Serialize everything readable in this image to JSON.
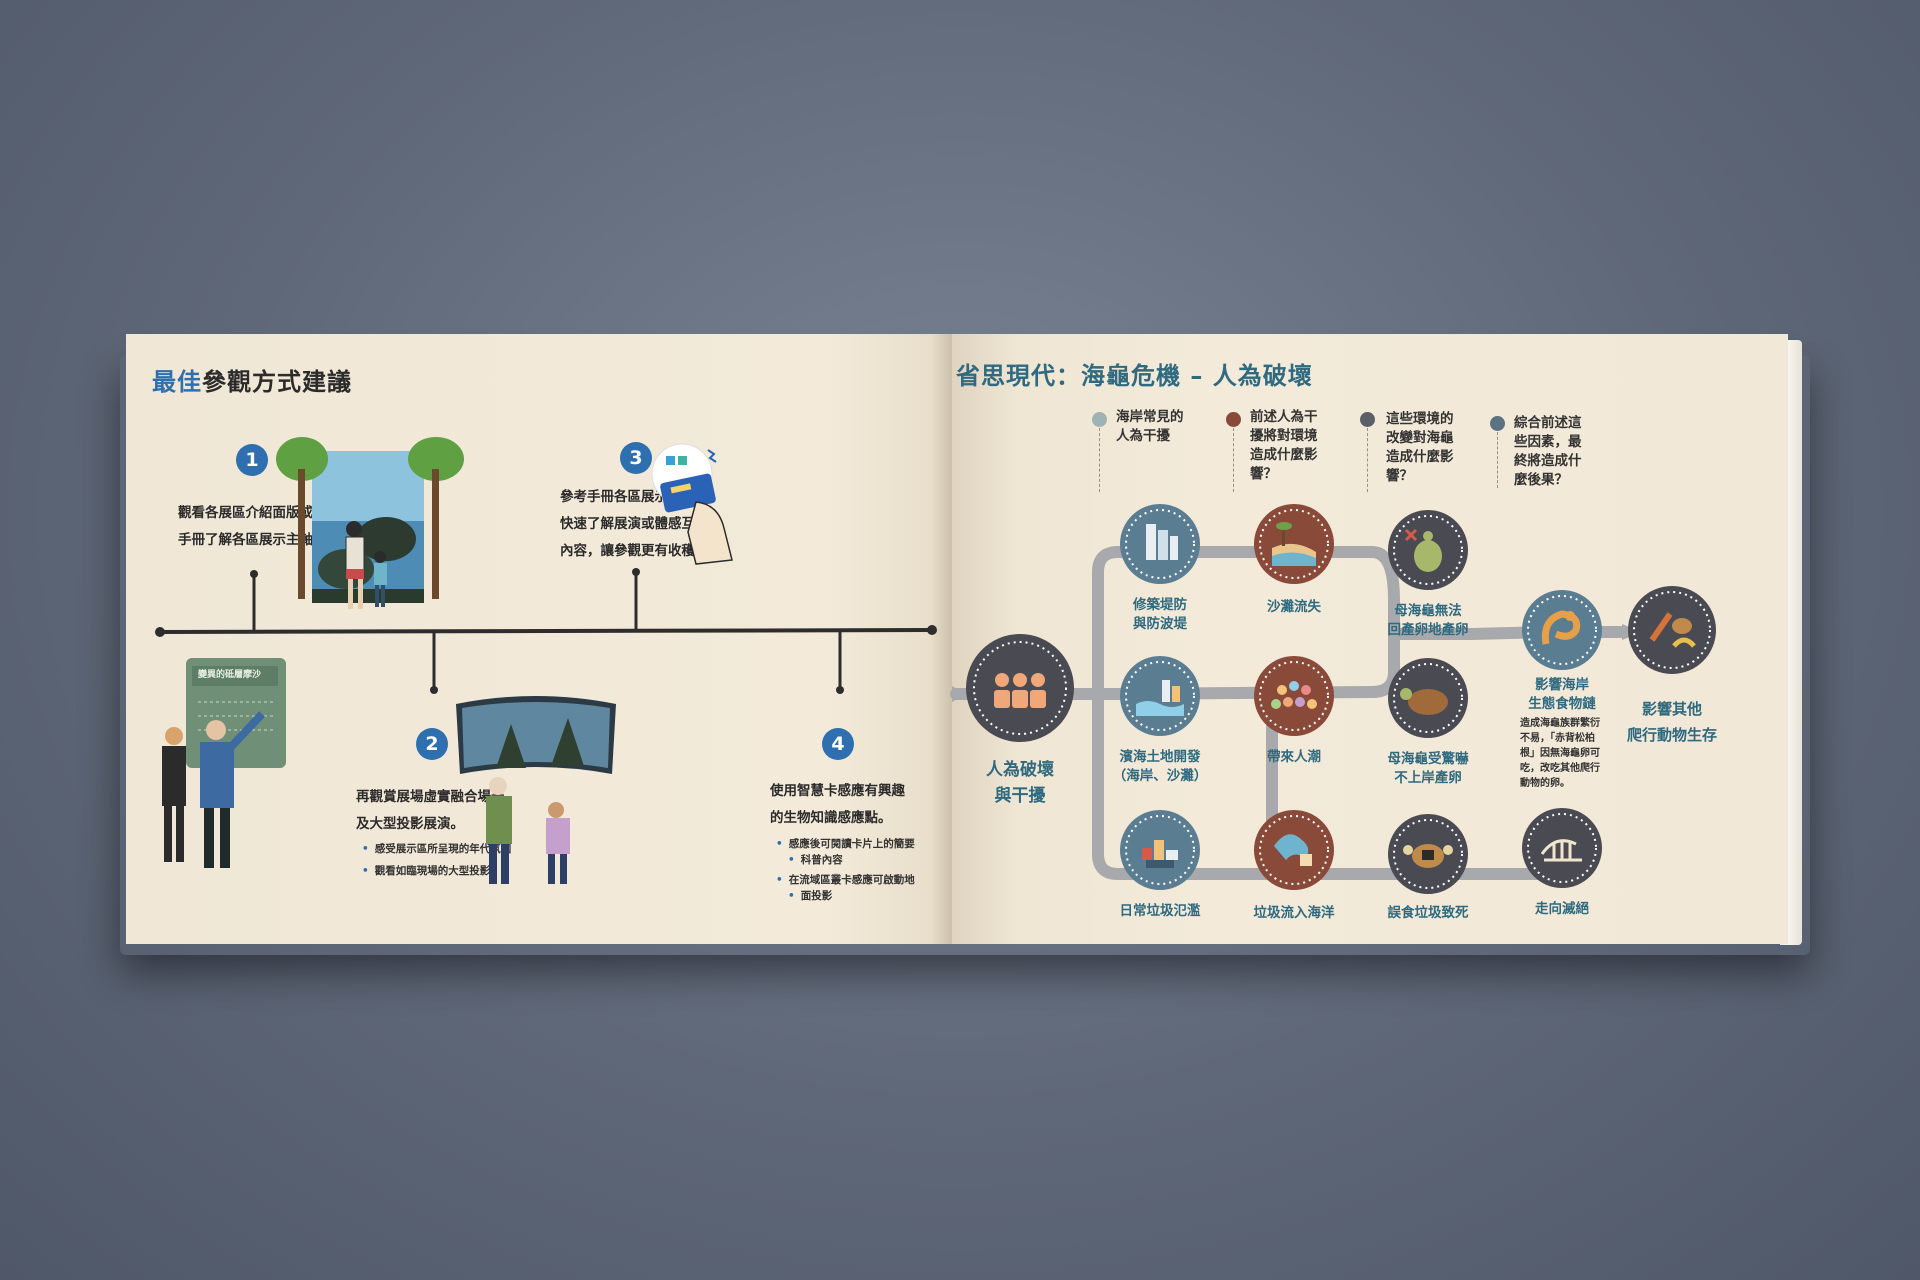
{
  "left_page": {
    "title_highlight": "最佳",
    "title_rest": "參觀方式建議",
    "steps": [
      {
        "number": "1",
        "lines": [
          "觀看各展區介紹面版或本",
          "手冊了解各區展示主軸。"
        ]
      },
      {
        "number": "2",
        "lines": [
          "再觀賞展場虛實融合場景",
          "及大型投影展演。"
        ],
        "bullets": [
          "感受展示區所呈現的年代氛圍",
          "觀看如臨現場的大型投影"
        ]
      },
      {
        "number": "3",
        "lines": [
          "參考手冊各區展示重點能",
          "快速了解展演或體感互動",
          "內容，讓參觀更有收穫！"
        ]
      },
      {
        "number": "4",
        "lines": [
          "使用智慧卡感應有興趣",
          "的生物知識感應點。"
        ],
        "bullets": [
          "感應後可閱讀卡片上的簡要",
          "科普內容",
          "在流域區叢卡感應可啟動地",
          "面投影"
        ]
      }
    ],
    "board_text": "變異的砥層摩沙"
  },
  "right_page": {
    "title": "省思現代：海龜危機 – 人為破壞",
    "questions": [
      {
        "lines": [
          "海岸常見的",
          "人為干擾"
        ],
        "color": "#9fb2b4"
      },
      {
        "lines": [
          "前述人為干",
          "擾將對環境",
          "造成什麼影",
          "響？"
        ],
        "color": "#8a4a3a"
      },
      {
        "lines": [
          "這些環境的",
          "改變對海龜",
          "造成什麼影",
          "響？"
        ],
        "color": "#5d5f68"
      },
      {
        "lines": [
          "綜合前述這",
          "些因素，最",
          "終將造成什",
          "麼後果？"
        ],
        "color": "#5a7282"
      }
    ],
    "start_node": {
      "lines": [
        "人為破壞",
        "與干擾"
      ]
    },
    "nodes_row1": [
      [
        "修築堤防",
        "與防波堤"
      ],
      [
        "沙灘流失"
      ],
      [
        "母海龜無法",
        "回產卵地產卵"
      ]
    ],
    "nodes_row2": [
      [
        "濱海土地開發",
        "（海岸、沙灘）"
      ],
      [
        "帶來人潮"
      ],
      [
        "母海龜受驚嚇",
        "不上岸產卵"
      ]
    ],
    "nodes_row3": [
      [
        "日常垃圾氾濫"
      ],
      [
        "垃圾流入海洋"
      ],
      [
        "誤食垃圾致死"
      ],
      [
        "走向滅絕"
      ]
    ],
    "food_chain": {
      "lines": [
        "影響海岸",
        "生態食物鏈"
      ],
      "note": [
        "造成海龜族群繁衍",
        "不易，「赤背松柏",
        "根」因無海龜卵可",
        "吃，改吃其他爬行",
        "動物的卵。"
      ]
    },
    "final": {
      "lines": [
        "影響其他",
        "爬行動物生存"
      ]
    }
  },
  "icons": {
    "start": "people-group-icon",
    "dam": "dam-icon",
    "beach": "beach-erosion-icon",
    "turtle_no": "turtle-cross-icon",
    "coastal": "coastal-development-icon",
    "crowd": "crowd-icon",
    "turtle_scared": "turtle-icon",
    "trash": "trash-pile-icon",
    "ocean_trash": "ocean-trash-icon",
    "eat_trash": "turtle-eating-trash-icon",
    "extinct": "skeleton-icon",
    "snake": "snake-icon",
    "reptiles": "reptiles-icon"
  },
  "colors": {
    "accent_blue": "#2e6fb0",
    "teal_text": "#2f6a80",
    "node_blue": "#5b7d92",
    "node_brown": "#8a4a3a",
    "node_dark": "#4a4a52",
    "path_gray": "#a7a9ac"
  }
}
